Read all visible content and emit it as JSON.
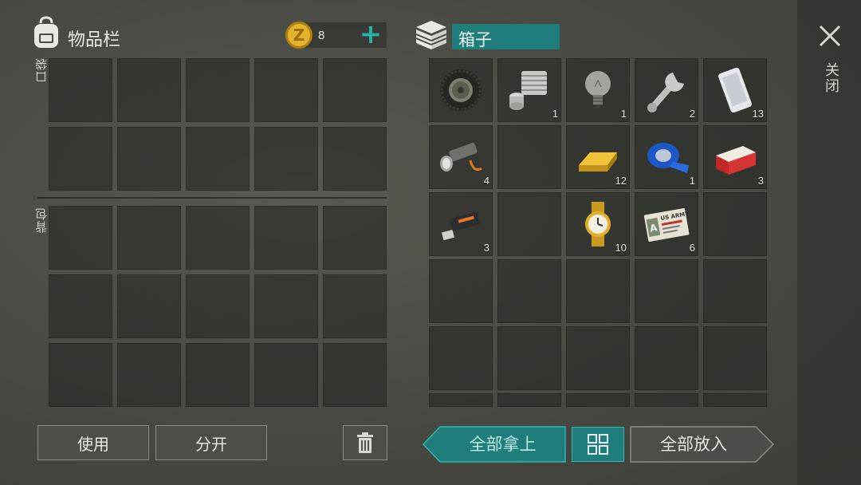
{
  "inventory": {
    "title": "物品栏",
    "coins": "8",
    "add_label": "+",
    "pocket_label": "口袋",
    "backpack_label": "背包"
  },
  "container": {
    "title": "箱子",
    "items": [
      {
        "icon": "tire-icon",
        "qty": ""
      },
      {
        "icon": "engine-cylinder-icon",
        "qty": "1"
      },
      {
        "icon": "light-bulb-icon",
        "qty": "1"
      },
      {
        "icon": "wrench-icon",
        "qty": "2"
      },
      {
        "icon": "smartphone-icon",
        "qty": "13"
      },
      {
        "icon": "flashlight-icon",
        "qty": "4"
      },
      {
        "icon": "",
        "qty": ""
      },
      {
        "icon": "gold-bar-icon",
        "qty": "12"
      },
      {
        "icon": "blue-tape-icon",
        "qty": "1"
      },
      {
        "icon": "cigarette-pack-icon",
        "qty": "3"
      },
      {
        "icon": "usb-drive-icon",
        "qty": "3"
      },
      {
        "icon": "",
        "qty": ""
      },
      {
        "icon": "gold-watch-icon",
        "qty": "10"
      },
      {
        "icon": "army-id-card-icon",
        "qty": "6"
      },
      {
        "icon": "",
        "qty": ""
      }
    ],
    "id_card_text": "US ARMY",
    "id_card_letter": "A"
  },
  "buttons": {
    "use": "使用",
    "split": "分开",
    "take_all": "全部拿上",
    "put_all": "全部放入"
  },
  "close": {
    "label": "关闭",
    "icon": "close-icon"
  },
  "colors": {
    "accent": "#1f7e7b",
    "accent_light": "#2fb7b0",
    "coin": "#d9a520"
  }
}
